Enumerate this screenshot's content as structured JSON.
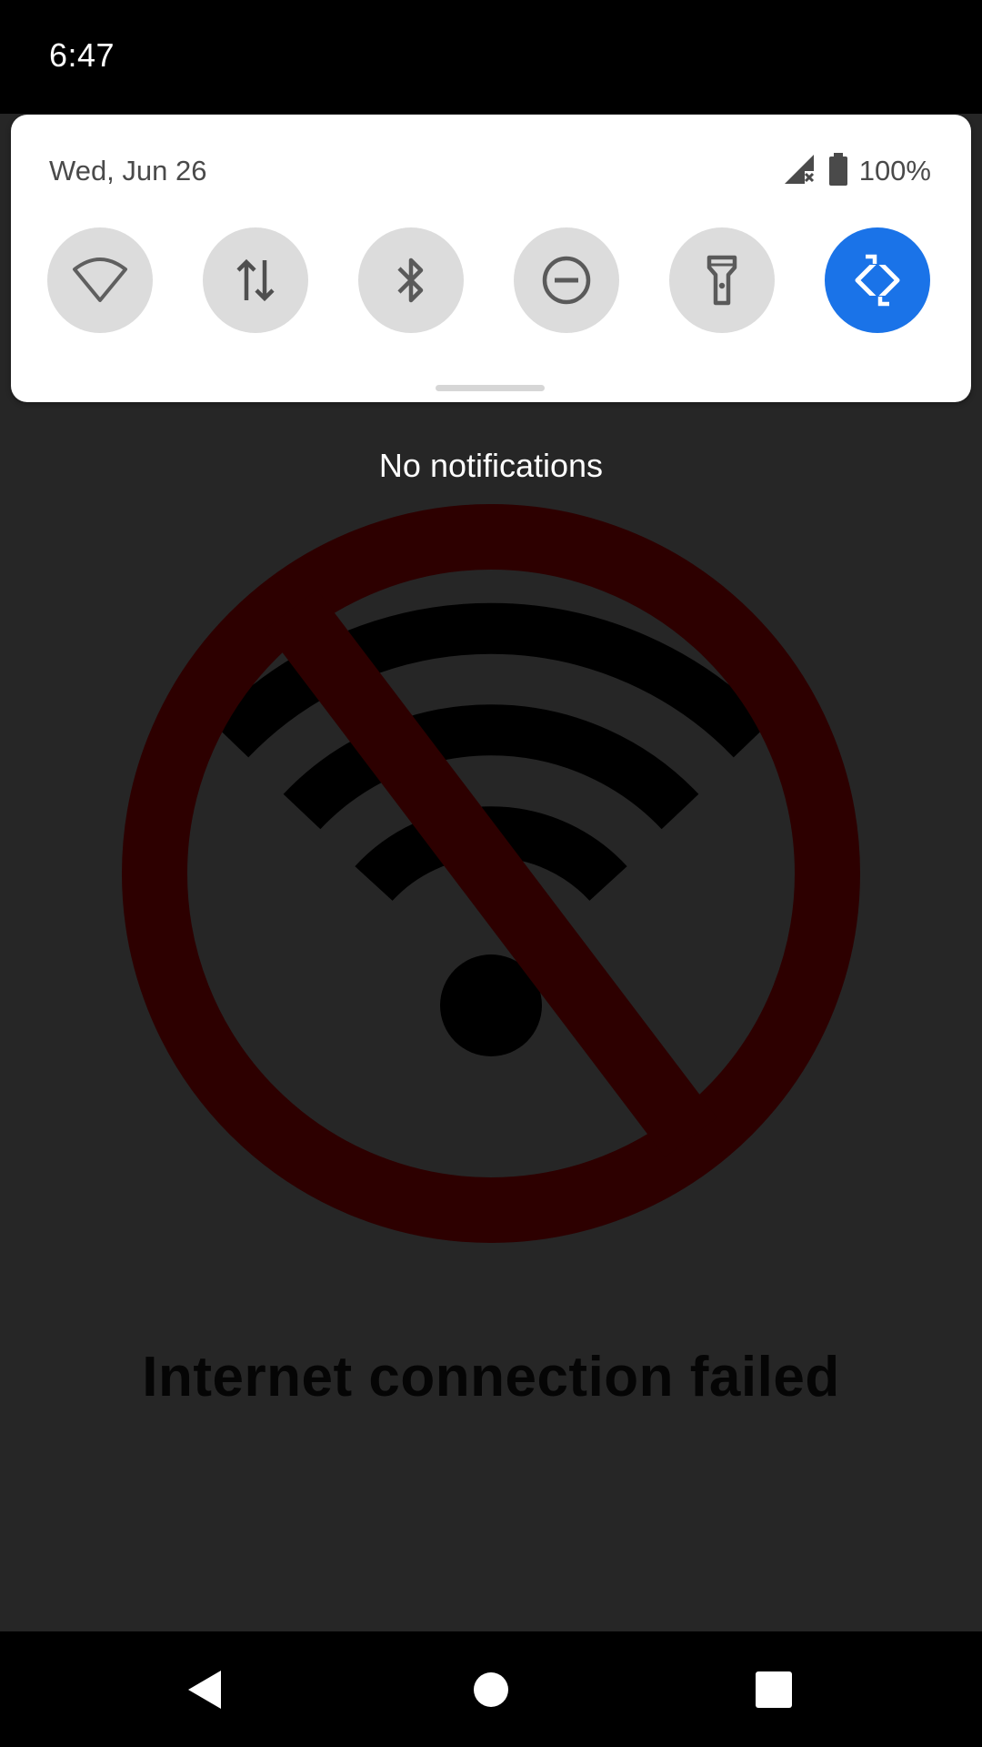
{
  "status_bar": {
    "time": "6:47"
  },
  "quick_settings": {
    "date": "Wed, Jun 26",
    "battery_percent": "100%",
    "status_icons": [
      "no-signal-icon",
      "battery-icon"
    ],
    "tiles": [
      {
        "name": "wifi",
        "icon": "wifi-icon",
        "active": false
      },
      {
        "name": "mobile-data",
        "icon": "data-arrows-icon",
        "active": false
      },
      {
        "name": "bluetooth",
        "icon": "bluetooth-icon",
        "active": false
      },
      {
        "name": "do-not-disturb",
        "icon": "dnd-icon",
        "active": false
      },
      {
        "name": "flashlight",
        "icon": "flashlight-icon",
        "active": false
      },
      {
        "name": "auto-rotate",
        "icon": "auto-rotate-icon",
        "active": true
      }
    ],
    "active_color": "#1a73e8"
  },
  "notifications": {
    "empty_text": "No notifications"
  },
  "app": {
    "error_message": "Internet connection failed",
    "illustration": "no-wifi-icon"
  },
  "nav_bar": {
    "buttons": [
      "back",
      "home",
      "recents"
    ]
  }
}
